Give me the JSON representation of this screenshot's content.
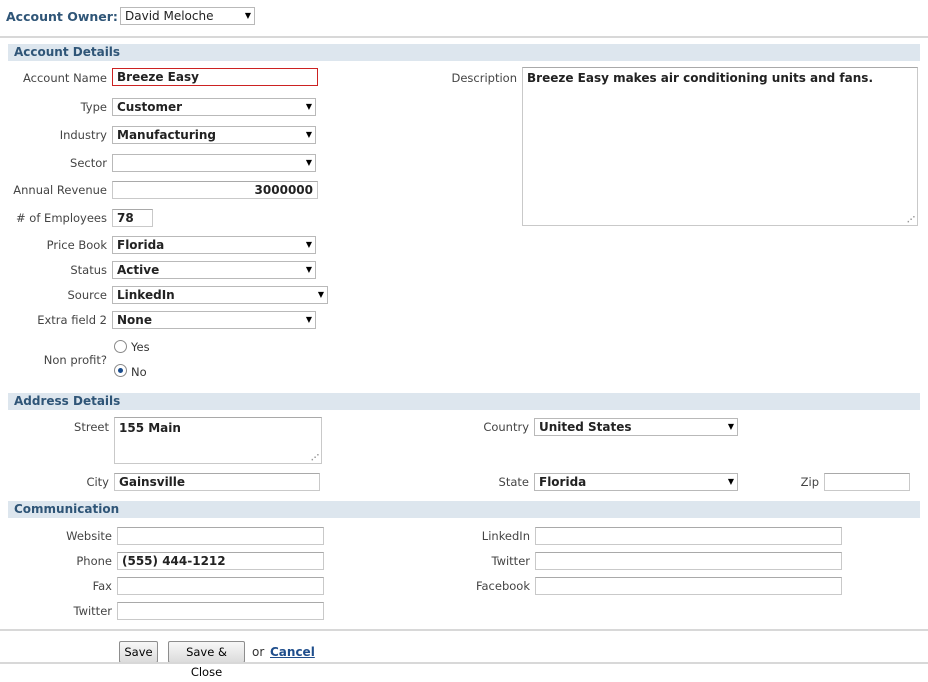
{
  "header": {
    "owner_label": "Account Owner:",
    "owner_value": "David Meloche"
  },
  "sections": {
    "account": "Account Details",
    "address": "Address Details",
    "communication": "Communication"
  },
  "account": {
    "name_label": "Account Name",
    "name_value": "Breeze Easy",
    "type_label": "Type",
    "type_value": "Customer",
    "industry_label": "Industry",
    "industry_value": "Manufacturing",
    "sector_label": "Sector",
    "sector_value": "",
    "revenue_label": "Annual Revenue",
    "revenue_value": "3000000",
    "employees_label": "# of Employees",
    "employees_value": "78",
    "pricebook_label": "Price Book",
    "pricebook_value": "Florida",
    "status_label": "Status",
    "status_value": "Active",
    "source_label": "Source",
    "source_value": "LinkedIn",
    "extra_label": "Extra field 2",
    "extra_value": "None",
    "nonprofit_label": "Non profit?",
    "nonprofit_yes": "Yes",
    "nonprofit_no": "No",
    "nonprofit_selected": "No",
    "description_label": "Description",
    "description_value": "Breeze Easy makes air conditioning units and fans."
  },
  "address": {
    "street_label": "Street",
    "street_value": "155 Main",
    "country_label": "Country",
    "country_value": "United States",
    "city_label": "City",
    "city_value": "Gainsville",
    "state_label": "State",
    "state_value": "Florida",
    "zip_label": "Zip",
    "zip_value": ""
  },
  "communication": {
    "website_label": "Website",
    "website_value": "",
    "phone_label": "Phone",
    "phone_value": "(555) 444-1212",
    "fax_label": "Fax",
    "fax_value": "",
    "twitter_left_label": "Twitter",
    "twitter_left_value": "",
    "linkedin_label": "LinkedIn",
    "linkedin_value": "",
    "twitter_right_label": "Twitter",
    "twitter_right_value": "",
    "facebook_label": "Facebook",
    "facebook_value": ""
  },
  "actions": {
    "save": "Save",
    "save_close": "Save & Close",
    "or": "or",
    "cancel": "Cancel"
  },
  "colors": {
    "section_bg": "#dde6ee",
    "section_text": "#2f5577",
    "link": "#1f4e8c",
    "error_border": "#cc2222"
  }
}
